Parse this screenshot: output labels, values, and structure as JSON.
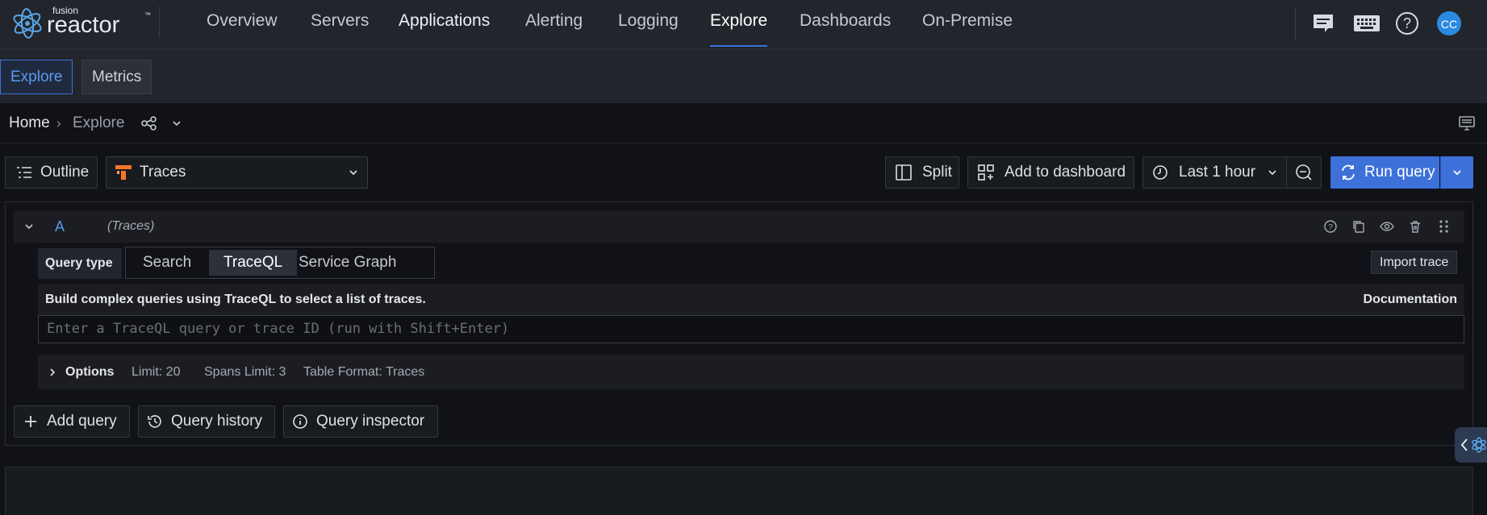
{
  "brand": {
    "small": "fusion",
    "name": "reactor",
    "tm": "™"
  },
  "nav": {
    "items": [
      {
        "label": "Overview"
      },
      {
        "label": "Servers"
      },
      {
        "label": "Applications"
      },
      {
        "label": "Alerting"
      },
      {
        "label": "Logging"
      },
      {
        "label": "Explore"
      },
      {
        "label": "Dashboards"
      },
      {
        "label": "On-Premise"
      }
    ],
    "active": "Explore",
    "icons": [
      "chat-icon",
      "keyboard-icon",
      "help-icon"
    ],
    "avatar_initials": "CC"
  },
  "subtabs": [
    {
      "label": "Explore"
    },
    {
      "label": "Metrics"
    }
  ],
  "breadcrumb": {
    "home": "Home",
    "separator": "›",
    "current": "Explore"
  },
  "toolbar": {
    "outline": "Outline",
    "datasource": "Traces",
    "split": "Split",
    "add_to_dashboard": "Add to dashboard",
    "time_range": "Last 1 hour",
    "run_query": "Run query"
  },
  "query": {
    "ref": "A",
    "datasource_note": "(Traces)",
    "query_type_label": "Query type",
    "query_types": [
      "Search",
      "TraceQL",
      "Service Graph"
    ],
    "active_type": "TraceQL",
    "import_trace": "Import trace",
    "description": "Build complex queries using TraceQL to select a list of traces.",
    "documentation": "Documentation",
    "placeholder": "Enter a TraceQL query or trace ID (run with Shift+Enter)",
    "value": "",
    "options_label": "Options",
    "options": [
      "Limit: 20",
      "Spans Limit: 3",
      "Table Format: Traces"
    ]
  },
  "actions": {
    "add_query": "Add query",
    "query_history": "Query history",
    "query_inspector": "Query inspector"
  },
  "colors": {
    "accent": "#3d71d9",
    "nav_bg": "#22252b",
    "page_bg": "#111217",
    "traces_icon": "#f5772b"
  }
}
